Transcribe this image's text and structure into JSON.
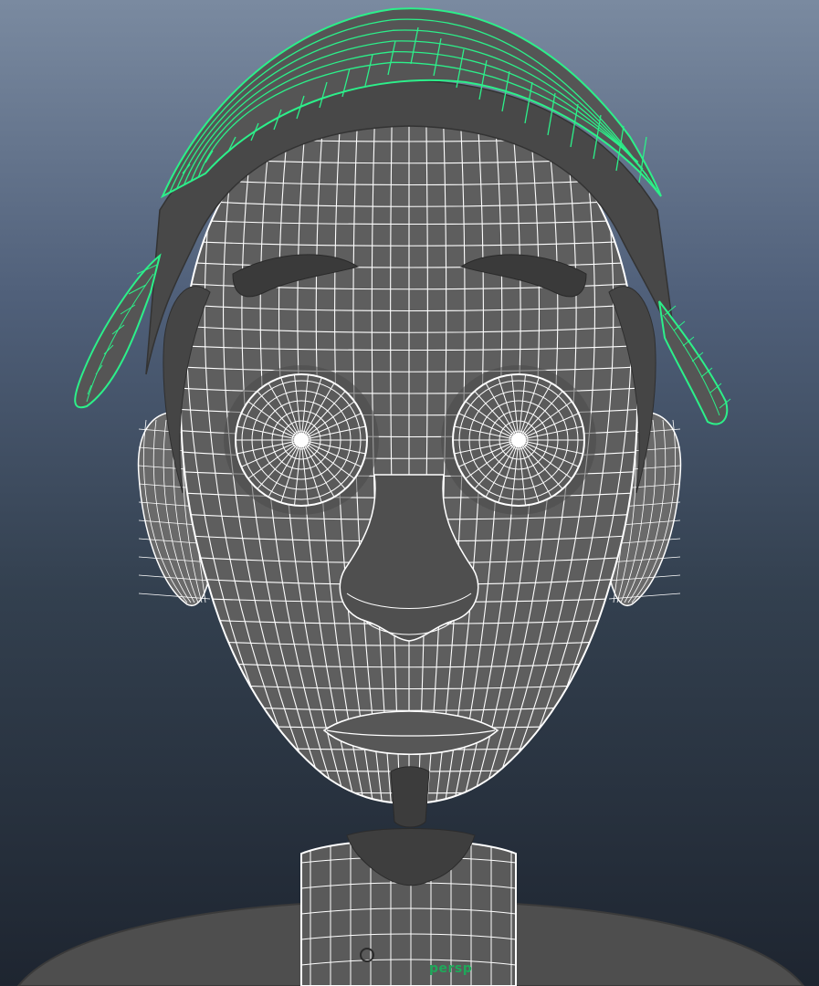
{
  "viewport": {
    "camera_label": "persp"
  },
  "colors": {
    "background_top": "#7a8aa0",
    "background_bottom": "#1e2530",
    "mesh_surface": "#5c5c5c",
    "wireframe": "#ffffff",
    "selected_wireframe": "#2cf08a",
    "hair": "#4a4a4a"
  }
}
